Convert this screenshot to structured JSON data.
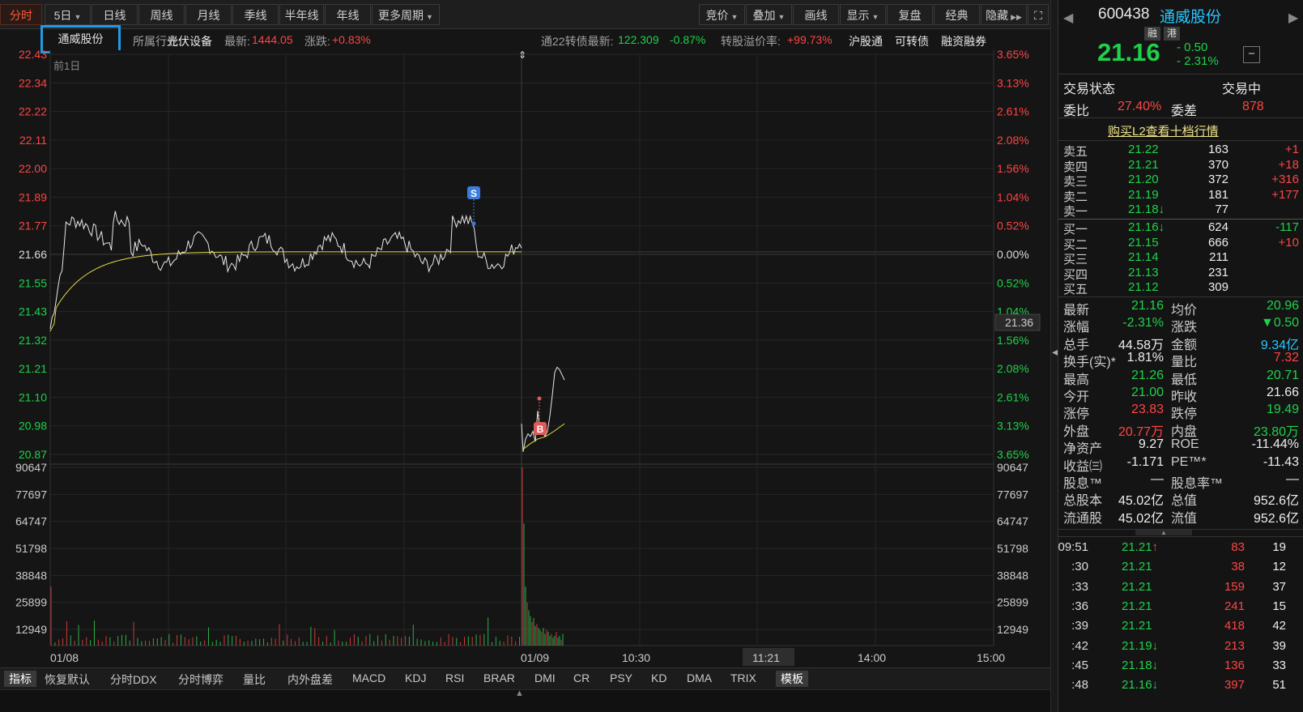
{
  "toolbar": {
    "left_tabs": [
      "分时",
      "5日",
      "日线",
      "周线",
      "月线",
      "季线",
      "半年线",
      "年线",
      "更多周期"
    ],
    "right_tabs": [
      "竞价",
      "叠加",
      "画线",
      "显示",
      "复盘",
      "经典",
      "隐藏"
    ]
  },
  "info": {
    "stock_name": "通威股份",
    "industry_label": "所属行业:",
    "industry": "光伏设备",
    "latest_label": "最新:",
    "latest": "1444.05",
    "change_label": "涨跌:",
    "change": "+0.83%",
    "bond_label": "通22转债最新:",
    "bond_price": "122.309",
    "bond_change": "-0.87%",
    "premium_label": "转股溢价率:",
    "premium": "+99.73%",
    "links": [
      "沪股通",
      "可转债",
      "融资融券"
    ]
  },
  "chart_data": {
    "type": "line",
    "prev_day_label": "前1日",
    "price_axis": [
      "22.43",
      "22.34",
      "22.22",
      "22.11",
      "22.00",
      "21.89",
      "21.77",
      "21.66",
      "21.55",
      "21.43",
      "21.32",
      "21.21",
      "21.10",
      "20.98",
      "20.87"
    ],
    "pct_axis_day1": [
      "3.65%",
      "3.13%",
      "2.61%",
      "2.08%",
      "1.56%",
      "1.04%",
      "0.52%",
      "0.00%",
      "0.52%",
      "1.04%"
    ],
    "pct_axis_day2": [
      "1.56%",
      "2.08%",
      "2.61%",
      "3.13%",
      "3.65%"
    ],
    "crosshair_price": "21.36",
    "volume_axis": [
      "90647",
      "77697",
      "64747",
      "51798",
      "38848",
      "25899",
      "12949"
    ],
    "time_labels": [
      "01/08",
      "01/09",
      "10:30",
      "11:21",
      "14:00",
      "15:00"
    ],
    "prev_close": 21.66,
    "day1_price_range": [
      21.33,
      21.9
    ],
    "day2_price_range": [
      20.88,
      21.21
    ],
    "markers": [
      "S",
      "B"
    ],
    "volume_max": 90647
  },
  "right": {
    "code": "600438",
    "name": "通威股份",
    "tags": [
      "融",
      "港"
    ],
    "price": "21.16",
    "change": "- 0.50",
    "change_pct": "- 2.31%",
    "status_label": "交易状态",
    "status": "交易中",
    "weibi_label": "委比",
    "weibi": "27.40%",
    "weicha_label": "委差",
    "weicha": "878",
    "l2_link": "购买L2查看十档行情",
    "sells": [
      {
        "label": "卖五",
        "price": "21.22",
        "vol": "163",
        "delta": "+1"
      },
      {
        "label": "卖四",
        "price": "21.21",
        "vol": "370",
        "delta": "+18"
      },
      {
        "label": "卖三",
        "price": "21.20",
        "vol": "372",
        "delta": "+316"
      },
      {
        "label": "卖二",
        "price": "21.19",
        "vol": "181",
        "delta": "+177"
      },
      {
        "label": "卖一",
        "price": "21.18↓",
        "vol": "77",
        "delta": ""
      }
    ],
    "buys": [
      {
        "label": "买一",
        "price": "21.16↓",
        "vol": "624",
        "delta": "-117"
      },
      {
        "label": "买二",
        "price": "21.15",
        "vol": "666",
        "delta": "+10"
      },
      {
        "label": "买三",
        "price": "21.14",
        "vol": "211",
        "delta": ""
      },
      {
        "label": "买四",
        "price": "21.13",
        "vol": "231",
        "delta": ""
      },
      {
        "label": "买五",
        "price": "21.12",
        "vol": "309",
        "delta": ""
      }
    ],
    "stats": [
      {
        "l1": "最新",
        "v1": "21.16",
        "c1": "green",
        "l2": "均价",
        "v2": "20.96",
        "c2": "green"
      },
      {
        "l1": "涨幅",
        "v1": "-2.31%",
        "c1": "green",
        "l2": "涨跌",
        "v2": "▼0.50",
        "c2": "green"
      },
      {
        "l1": "总手",
        "v1": "44.58万",
        "c1": "white",
        "l2": "金额",
        "v2": "9.34亿",
        "c2": "cyan"
      },
      {
        "l1": "换手(实)*",
        "v1": "1.81%",
        "c1": "white",
        "l2": "量比",
        "v2": "7.32",
        "c2": "red"
      },
      {
        "l1": "最高",
        "v1": "21.26",
        "c1": "green",
        "l2": "最低",
        "v2": "20.71",
        "c2": "green"
      },
      {
        "l1": "今开",
        "v1": "21.00",
        "c1": "green",
        "l2": "昨收",
        "v2": "21.66",
        "c2": "white"
      },
      {
        "l1": "涨停",
        "v1": "23.83",
        "c1": "red",
        "l2": "跌停",
        "v2": "19.49",
        "c2": "green"
      },
      {
        "l1": "外盘",
        "v1": "20.77万",
        "c1": "red",
        "l2": "内盘",
        "v2": "23.80万",
        "c2": "green"
      },
      {
        "l1": "净资产",
        "v1": "9.27",
        "c1": "white",
        "l2": "ROE",
        "v2": "-11.44%",
        "c2": "white"
      },
      {
        "l1": "收益㈢",
        "v1": "-1.171",
        "c1": "white",
        "l2": "PE™*",
        "v2": "-11.43",
        "c2": "white"
      },
      {
        "l1": "股息™",
        "v1": "—",
        "c1": "white",
        "l2": "股息率™",
        "v2": "—",
        "c2": "white"
      },
      {
        "l1": "总股本",
        "v1": "45.02亿",
        "c1": "white",
        "l2": "总值",
        "v2": "952.6亿",
        "c2": "white"
      },
      {
        "l1": "流通股",
        "v1": "45.02亿",
        "c1": "white",
        "l2": "流值",
        "v2": "952.6亿",
        "c2": "white"
      }
    ],
    "ticks": [
      {
        "time": "09:51",
        "price": "21.21↑",
        "vol": "83",
        "num": "19"
      },
      {
        "time": ":30",
        "price": "21.21",
        "vol": "38",
        "num": "12"
      },
      {
        "time": ":33",
        "price": "21.21",
        "vol": "159",
        "num": "37"
      },
      {
        "time": ":36",
        "price": "21.21",
        "vol": "241",
        "num": "15"
      },
      {
        "time": ":39",
        "price": "21.21",
        "vol": "418",
        "num": "42"
      },
      {
        "time": ":42",
        "price": "21.19↓",
        "vol": "213",
        "num": "39"
      },
      {
        "time": ":45",
        "price": "21.18↓",
        "vol": "136",
        "num": "33"
      },
      {
        "time": ":48",
        "price": "21.16↓",
        "vol": "397",
        "num": "51"
      }
    ]
  },
  "indicators": [
    "指标",
    "恢复默认",
    "分时DDX",
    "分时博弈",
    "量比",
    "内外盘差",
    "MACD",
    "KDJ",
    "RSI",
    "BRAR",
    "DMI",
    "CR",
    "PSY",
    "KD",
    "DMA",
    "TRIX",
    "模板"
  ],
  "colors": {
    "up": "#ff4444",
    "down": "#1fd14a",
    "price_line": "#e8e8e8",
    "avg_line": "#e6d94a",
    "accent": "#1e9be8"
  }
}
